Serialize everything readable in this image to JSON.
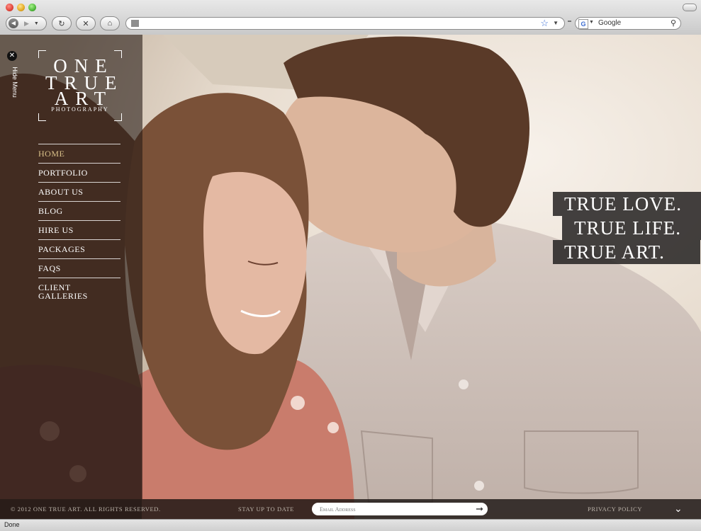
{
  "browser": {
    "url": "",
    "search_engine": "Google",
    "status": "Done"
  },
  "site": {
    "logo_lines": [
      "ONE",
      "TRUE",
      "ART"
    ],
    "logo_sub": "PHOTOGRAPHY",
    "hide_menu": "Hide Menu",
    "nav": [
      {
        "label": "HOME",
        "active": true
      },
      {
        "label": "PORTFOLIO"
      },
      {
        "label": "ABOUT US"
      },
      {
        "label": "BLOG"
      },
      {
        "label": "HIRE US"
      },
      {
        "label": "PACKAGES"
      },
      {
        "label": "FAQS"
      },
      {
        "label": "CLIENT\nGALLERIES"
      }
    ],
    "tagline": [
      "TRUE LOVE.",
      "TRUE LIFE.",
      "TRUE ART."
    ]
  },
  "footer": {
    "copyright": "© 2012 ONE TRUE ART. ALL RIGHTS RESERVED.",
    "stay_label": "STAY UP TO DATE",
    "email_placeholder": "Email Address",
    "privacy": "PRIVACY POLICY"
  },
  "colors": {
    "nav_active": "#d9c089",
    "sidebar_bg": "rgba(38,26,22,0.6)",
    "tag_bg": "#232121"
  }
}
